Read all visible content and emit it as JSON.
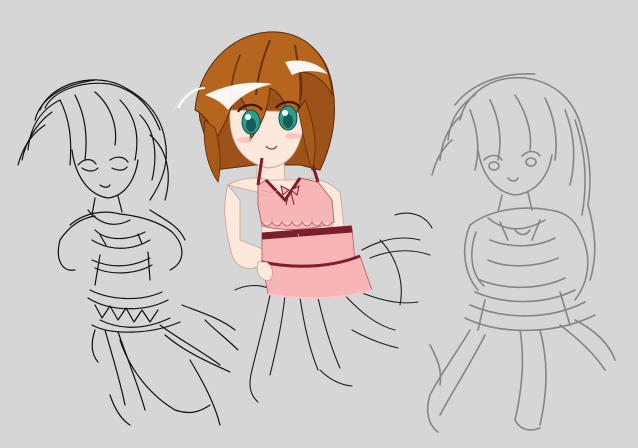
{
  "canvas": {
    "background": "#d6d6d6"
  },
  "figures": [
    {
      "id": "left",
      "style": "black line sketch"
    },
    {
      "id": "center",
      "style": "coloured drawing"
    },
    {
      "id": "right",
      "style": "grey line sketch"
    }
  ],
  "colors": {
    "skin": "#fde8dc",
    "hair_brown": "#b5651d",
    "hair_dark": "#7a3d12",
    "hair_highlight": "#ffffff",
    "eye_teal": "#2a9d8f",
    "outfit_pink": "#f7b5b5",
    "outfit_trim": "#7b1f2e",
    "sketch_black": "#111111",
    "sketch_grey": "#858585"
  }
}
